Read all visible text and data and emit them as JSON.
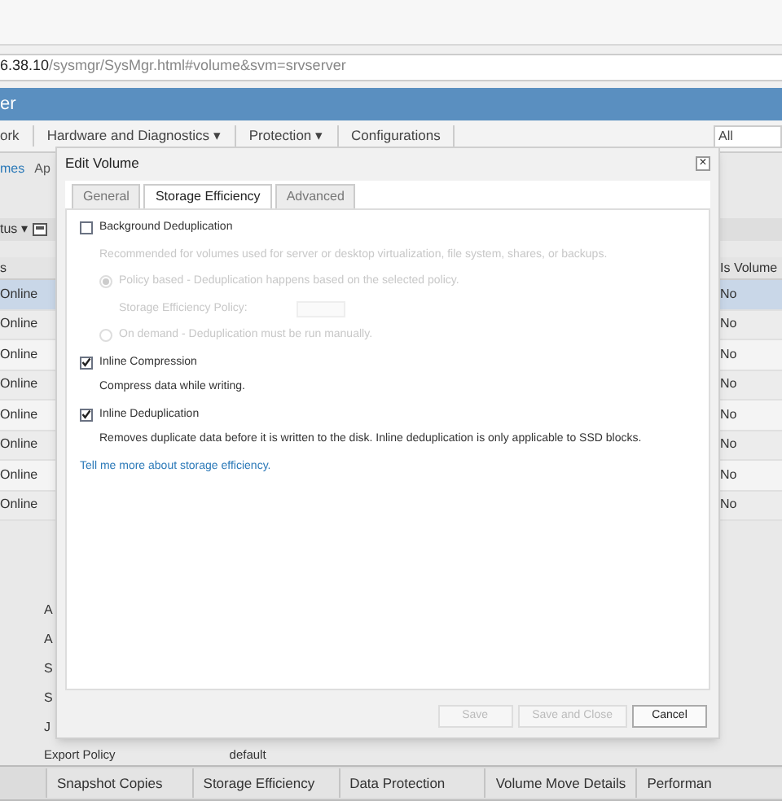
{
  "address_bar": {
    "host": "6.38.10",
    "path": "/sysmgr/SysMgr.html#volume&svm=srvserver"
  },
  "header": {
    "title": "er"
  },
  "nav": [
    {
      "label": "ork"
    },
    {
      "label": "Hardware and Diagnostics ▾"
    },
    {
      "label": "Protection ▾"
    },
    {
      "label": "Configurations"
    }
  ],
  "filter": {
    "value": "All"
  },
  "subnav": [
    {
      "label": "mes",
      "selected": true
    },
    {
      "label": "Ap",
      "selected": false
    }
  ],
  "toolbar": {
    "label": "tus ▾"
  },
  "table": {
    "columns": [
      "s",
      "Is Volume"
    ],
    "rows": [
      {
        "status": "Online",
        "is_volume": "No",
        "selected": true
      },
      {
        "status": "Online",
        "is_volume": "No",
        "selected": false
      },
      {
        "status": "Online",
        "is_volume": "No",
        "selected": false
      },
      {
        "status": "Online",
        "is_volume": "No",
        "selected": false
      },
      {
        "status": "Online",
        "is_volume": "No",
        "selected": false
      },
      {
        "status": "Online",
        "is_volume": "No",
        "selected": false
      },
      {
        "status": "Online",
        "is_volume": "No",
        "selected": false
      },
      {
        "status": "Online",
        "is_volume": "No",
        "selected": false
      }
    ]
  },
  "details": {
    "labels": [
      "A",
      "A",
      "S",
      "S",
      "J"
    ],
    "last_label": "Export Policy",
    "last_value": "default"
  },
  "bottom_tabs": [
    {
      "label": "Snapshot Copies"
    },
    {
      "label": "Storage Efficiency"
    },
    {
      "label": "Data Protection"
    },
    {
      "label": "Volume Move Details"
    },
    {
      "label": "Performan"
    }
  ],
  "dialog": {
    "title": "Edit Volume",
    "close": "×",
    "tabs": [
      {
        "label": "General",
        "selected": false
      },
      {
        "label": "Storage Efficiency",
        "selected": true
      },
      {
        "label": "Advanced",
        "selected": false
      }
    ],
    "background_dedup": {
      "label": "Background Deduplication",
      "checked": false,
      "hint": "Recommended for volumes used for server or desktop virtualization, file system, shares, or backups.",
      "options": [
        {
          "label": "Policy based - Deduplication happens based on the selected policy.",
          "selected": true,
          "disabled": true
        },
        {
          "label": "On demand - Deduplication must be run manually.",
          "selected": false,
          "disabled": true
        }
      ],
      "policy_label": "Storage Efficiency Policy:"
    },
    "inline": [
      {
        "label": "Inline Compression",
        "checked": true,
        "hint": "Compress data while writing."
      },
      {
        "label": "Inline Deduplication",
        "checked": true,
        "hint": "Removes duplicate data before it is written to the disk. Inline deduplication is only applicable to SSD blocks."
      }
    ],
    "link": "Tell me more about storage efficiency.",
    "buttons": [
      {
        "label": "Save",
        "disabled": true
      },
      {
        "label": "Save and Close",
        "disabled": true
      },
      {
        "label": "Cancel",
        "disabled": false
      }
    ]
  }
}
